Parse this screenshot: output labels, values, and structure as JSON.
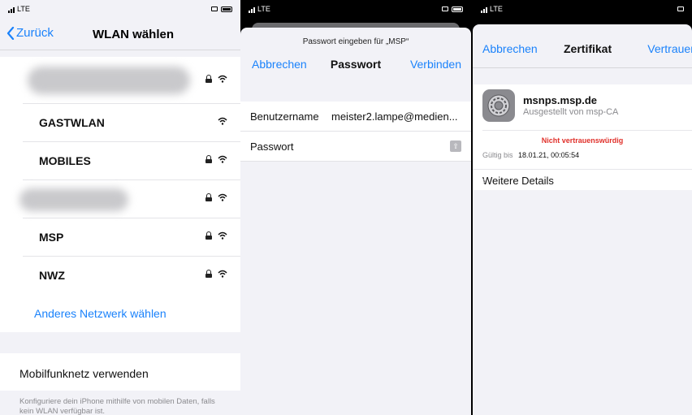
{
  "status": {
    "carrier": "LTE"
  },
  "wifi_list": {
    "back_label": "Zurück",
    "title": "WLAN wählen",
    "networks": [
      {
        "name": "GASTWLAN",
        "locked": false
      },
      {
        "name": "MOBILES",
        "locked": true
      },
      {
        "name": "MSP",
        "locked": true
      },
      {
        "name": "NWZ",
        "locked": true
      }
    ],
    "other_network_label": "Anderes Netzwerk wählen",
    "mobile_data_label": "Mobilfunknetz verwenden",
    "mobile_data_note": "Konfiguriere dein iPhone mithilfe von mobilen Daten, falls kein WLAN verfügbar ist."
  },
  "password_sheet": {
    "prompt": "Passwort eingeben für „MSP“",
    "cancel_label": "Abbrechen",
    "title": "Passwort",
    "connect_label": "Verbinden",
    "username_label": "Benutzername",
    "username_value": "meister2.lampe@medien...",
    "password_label": "Passwort"
  },
  "certificate_sheet": {
    "cancel_label": "Abbrechen",
    "title": "Zertifikat",
    "trust_label": "Vertrauen",
    "cert_name": "msnps.msp.de",
    "issued_by": "Ausgestellt von msp-CA",
    "untrusted_label": "Nicht vertrauenswürdig",
    "valid_until_label": "Gültig bis",
    "valid_until_value": "18.01.21, 00:05:54",
    "more_details_label": "Weitere Details"
  },
  "colors": {
    "accent": "#1a82fb",
    "warning": "#e0302a"
  }
}
